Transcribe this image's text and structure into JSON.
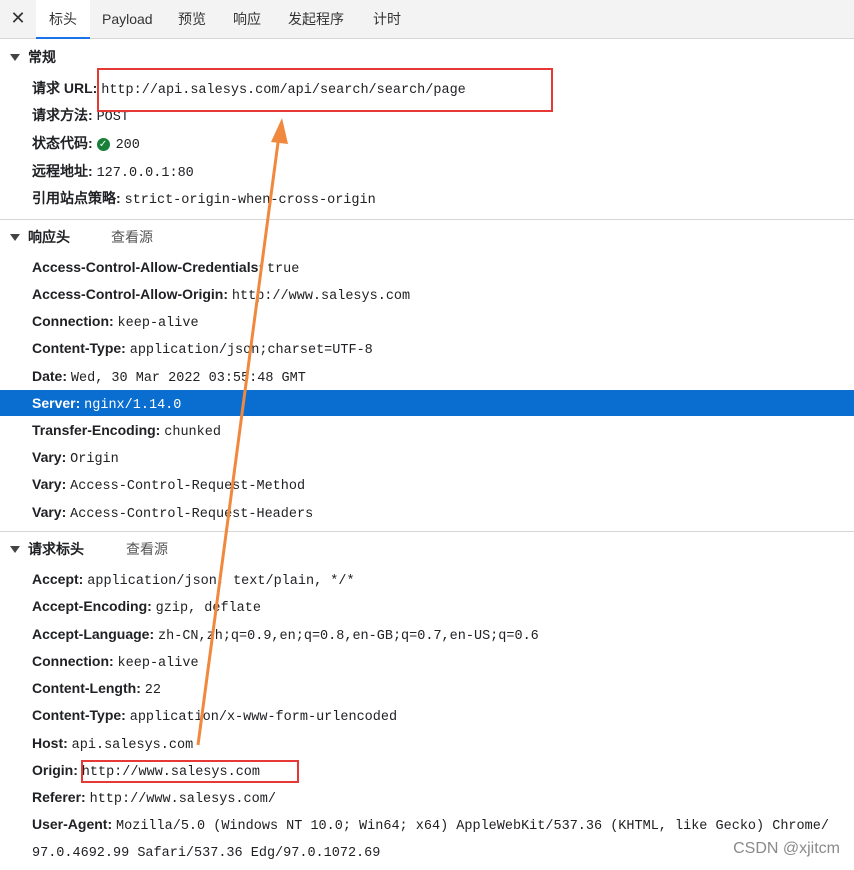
{
  "tabs": {
    "close_icon": "close-icon",
    "items": [
      "标头",
      "Payload",
      "预览",
      "响应",
      "发起程序",
      "计时"
    ],
    "active": "标头"
  },
  "general": {
    "title": "常规",
    "rows": [
      {
        "key": "请求 URL:",
        "value": "http://api.salesys.com/api/search/search/page"
      },
      {
        "key": "请求方法:",
        "value": "POST"
      },
      {
        "key": "状态代码:",
        "value": "200",
        "icon": "check-circle-icon",
        "status_color": "#188038"
      },
      {
        "key": "远程地址:",
        "value": "127.0.0.1:80"
      },
      {
        "key": "引用站点策略:",
        "value": "strict-origin-when-cross-origin"
      }
    ]
  },
  "response_headers": {
    "title": "响应头",
    "view_source": "查看源",
    "rows": [
      {
        "key": "Access-Control-Allow-Credentials:",
        "value": "true"
      },
      {
        "key": "Access-Control-Allow-Origin:",
        "value": "http://www.salesys.com"
      },
      {
        "key": "Connection:",
        "value": "keep-alive"
      },
      {
        "key": "Content-Type:",
        "value": "application/json;charset=UTF-8"
      },
      {
        "key": "Date:",
        "value": "Wed, 30 Mar 2022 03:55:48 GMT"
      },
      {
        "key": "Server:",
        "value": "nginx/1.14.0",
        "selected": true
      },
      {
        "key": "Transfer-Encoding:",
        "value": "chunked"
      },
      {
        "key": "Vary:",
        "value": "Origin"
      },
      {
        "key": "Vary:",
        "value": "Access-Control-Request-Method"
      },
      {
        "key": "Vary:",
        "value": "Access-Control-Request-Headers"
      }
    ]
  },
  "request_headers": {
    "title": "请求标头",
    "view_source": "查看源",
    "rows": [
      {
        "key": "Accept:",
        "value": "application/json, text/plain, */*"
      },
      {
        "key": "Accept-Encoding:",
        "value": "gzip, deflate"
      },
      {
        "key": "Accept-Language:",
        "value": "zh-CN,zh;q=0.9,en;q=0.8,en-GB;q=0.7,en-US;q=0.6"
      },
      {
        "key": "Connection:",
        "value": "keep-alive"
      },
      {
        "key": "Content-Length:",
        "value": "22"
      },
      {
        "key": "Content-Type:",
        "value": "application/x-www-form-urlencoded"
      },
      {
        "key": "Host:",
        "value": "api.salesys.com"
      },
      {
        "key": "Origin:",
        "value": "http://www.salesys.com"
      },
      {
        "key": "Referer:",
        "value": "http://www.salesys.com/"
      },
      {
        "key": "User-Agent:",
        "value": "Mozilla/5.0 (Windows NT 10.0; Win64; x64) AppleWebKit/537.36 (KHTML, like Gecko) Chrome/"
      },
      {
        "key": "",
        "value": "97.0.4692.99 Safari/537.36 Edg/97.0.1072.69"
      }
    ]
  },
  "colors": {
    "highlight_box": "#e53935",
    "arrow": "#f0883e",
    "selected_row": "#0a6ed1",
    "tab_accent": "#1a73e8"
  },
  "watermark": "CSDN @xjitcm"
}
